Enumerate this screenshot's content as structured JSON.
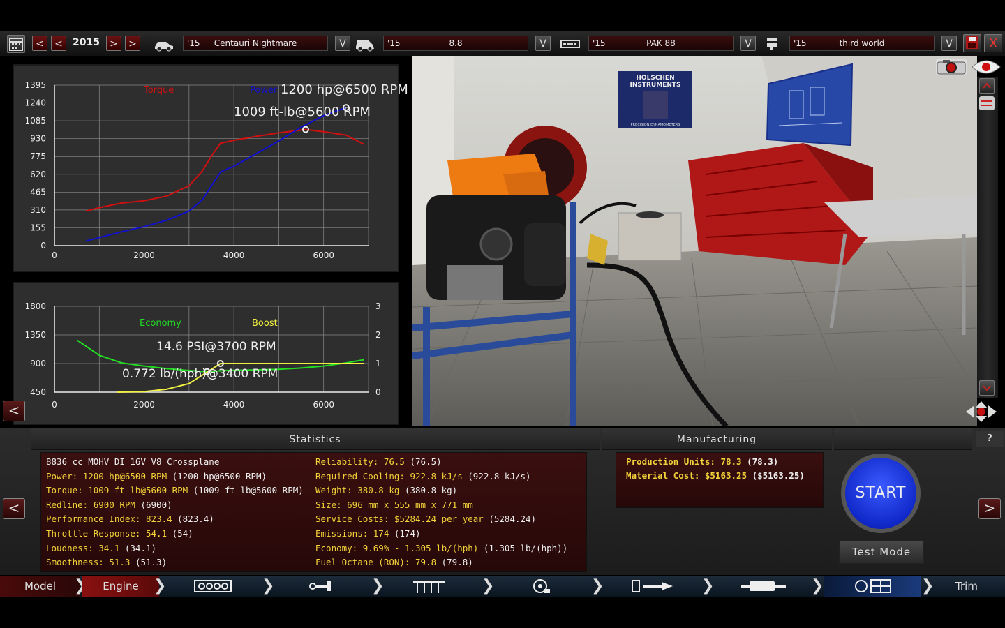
{
  "topbar": {
    "year": "2015",
    "selectors": [
      {
        "year": "'15",
        "name": "Centauri Nightmare"
      },
      {
        "year": "'15",
        "name": "8.8"
      },
      {
        "year": "'15",
        "name": "PAK 88"
      },
      {
        "year": "'15",
        "name": "third world"
      }
    ],
    "prev_label": "<",
    "next_label": ">",
    "dropdown_label": "V",
    "close_label": "X"
  },
  "power_chart": {
    "legend_torque": "Torque",
    "legend_power": "Power",
    "power_readout": "1200 hp@6500 RPM",
    "torque_readout": "1009 ft-lb@5600 RPM",
    "colors": {
      "torque": "#d01010",
      "power": "#1010d0"
    }
  },
  "economy_chart": {
    "legend_economy": "Economy",
    "legend_boost": "Boost",
    "boost_readout": "14.6 PSI@3700 RPM",
    "economy_readout": "0.772 lb/(hph)@3400 RPM",
    "colors": {
      "economy": "#22dd22",
      "boost": "#f0f040"
    }
  },
  "chart_data": [
    {
      "type": "line",
      "x_ticks": [
        "0",
        "2000",
        "4000",
        "6000"
      ],
      "y_ticks": [
        "0",
        "155",
        "310",
        "465",
        "620",
        "775",
        "930",
        "1085",
        "1240",
        "1395"
      ],
      "xlim": [
        0,
        7000
      ],
      "ylim": [
        0,
        1395
      ],
      "series": [
        {
          "name": "Torque",
          "x": [
            700,
            1000,
            1500,
            2000,
            2500,
            3000,
            3300,
            3500,
            3700,
            4000,
            4500,
            5000,
            5600,
            6000,
            6500,
            6900
          ],
          "y": [
            300,
            330,
            370,
            390,
            430,
            520,
            650,
            780,
            890,
            915,
            950,
            980,
            1009,
            990,
            960,
            880
          ]
        },
        {
          "name": "Power",
          "x": [
            700,
            1000,
            1500,
            2000,
            2500,
            3000,
            3300,
            3700,
            4000,
            4500,
            5000,
            5500,
            6000,
            6500
          ],
          "y": [
            40,
            70,
            120,
            165,
            220,
            300,
            400,
            640,
            690,
            800,
            910,
            1030,
            1130,
            1200
          ]
        }
      ],
      "grid": true
    },
    {
      "type": "line",
      "x_ticks": [
        "0",
        "2000",
        "4000",
        "6000"
      ],
      "y_ticks_left": [
        "450",
        "900",
        "1350",
        "1800"
      ],
      "y_ticks_right": [
        "0",
        "1",
        "2",
        "3"
      ],
      "xlim": [
        0,
        7000
      ],
      "ylim_left": [
        450,
        1800
      ],
      "ylim_right": [
        0,
        3
      ],
      "series": [
        {
          "name": "Economy",
          "axis": "left",
          "x": [
            500,
            1000,
            1500,
            2000,
            2500,
            3000,
            3400,
            3800,
            4500,
            5000,
            5500,
            6000,
            6500,
            6900
          ],
          "y": [
            1270,
            1030,
            910,
            860,
            820,
            790,
            772,
            790,
            800,
            810,
            830,
            860,
            910,
            960
          ]
        },
        {
          "name": "Boost",
          "axis": "right",
          "x": [
            1400,
            2000,
            2500,
            3000,
            3400,
            3700,
            4000,
            5000,
            6000,
            6900
          ],
          "y": [
            0,
            0.02,
            0.1,
            0.3,
            0.7,
            1.0,
            1.0,
            1.0,
            1.0,
            1.0
          ]
        }
      ],
      "grid": true
    }
  ],
  "statistics": {
    "header": "Statistics",
    "left": [
      {
        "key": "8836 cc MOHV DI 16V V8 Crossplane",
        "value": ""
      },
      {
        "key": "Power: 1200 hp@6500 RPM",
        "value": " (1200 hp@6500 RPM)"
      },
      {
        "key": "Torque: 1009 ft-lb@5600 RPM",
        "value": " (1009 ft-lb@5600 RPM)"
      },
      {
        "key": "Redline: 6900 RPM",
        "value": " (6900)"
      },
      {
        "key": "Performance Index: 823.4",
        "value": " (823.4)"
      },
      {
        "key": "Throttle Response: 54.1",
        "value": " (54)"
      },
      {
        "key": "Loudness: 34.1",
        "value": " (34.1)"
      },
      {
        "key": "Smoothness: 51.3",
        "value": " (51.3)"
      }
    ],
    "right": [
      {
        "key": "Reliability: 76.5",
        "value": " (76.5)"
      },
      {
        "key": "Required Cooling: 922.8 kJ/s",
        "value": " (922.8 kJ/s)"
      },
      {
        "key": "Weight: 380.8 kg",
        "value": " (380.8 kg)"
      },
      {
        "key": "Size: 696 mm x 555 mm x 771 mm",
        "value": ""
      },
      {
        "key": "Service Costs: $5284.24 per year",
        "value": " (5284.24)"
      },
      {
        "key": "Emissions: 174",
        "value": " (174)"
      },
      {
        "key": "Economy: 9.69% - 1.305 lb/(hph)",
        "value": " (1.305 lb/(hph))"
      },
      {
        "key": "Fuel Octane (RON): 79.8",
        "value": " (79.8)"
      }
    ]
  },
  "manufacturing": {
    "header": "Manufacturing",
    "production_units_key": "Production Units: 78.3",
    "production_units_value": " (78.3)",
    "material_cost_key": "Material Cost: $5163.25",
    "material_cost_value": " ($5163.25)"
  },
  "actions": {
    "help_label": "?",
    "start_label": "START",
    "test_mode_label": "Test Mode",
    "prev_label": "<",
    "next_label": ">"
  },
  "scene": {
    "poster_line1": "HOLSCHEN",
    "poster_line2": "INSTRUMENTS",
    "poster_line3": "PRECISION DYNAMOMETERS"
  },
  "navbar": {
    "model_label": "Model",
    "engine_label": "Engine",
    "trim_label": "Trim",
    "icons": [
      "block-icon",
      "crank-icon",
      "head-icon",
      "turbo-icon",
      "fuel-icon",
      "exhaust-icon",
      "dyno-icon"
    ]
  }
}
